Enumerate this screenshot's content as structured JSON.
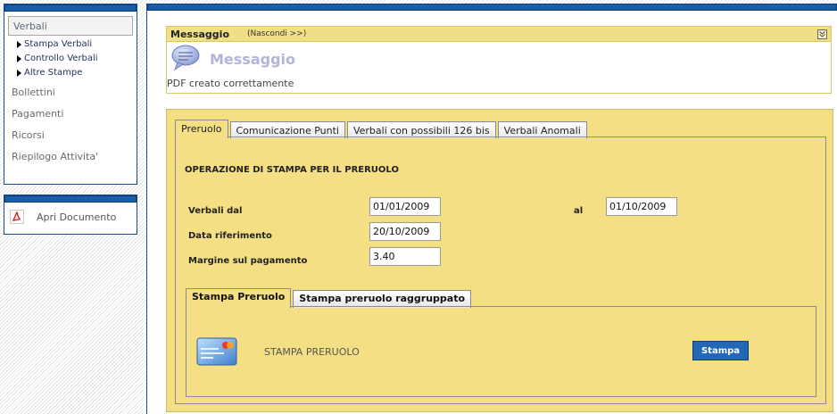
{
  "sidebar": {
    "section_header": "Verbali",
    "sub_items": [
      {
        "label": "Stampa Verbali"
      },
      {
        "label": "Controllo Verbali"
      },
      {
        "label": "Altre Stampe"
      }
    ],
    "nav_items": [
      {
        "label": "Bollettini"
      },
      {
        "label": "Pagamenti"
      },
      {
        "label": "Ricorsi"
      },
      {
        "label": "Riepilogo Attivita'"
      }
    ],
    "documents": {
      "open_label": "Apri Documento",
      "icon": "pdf-icon"
    }
  },
  "message": {
    "header_title": "Messaggio",
    "hide_link": "(Nascondi >>)",
    "heading": "Messaggio",
    "text": "PDF creato correttamente",
    "icons": [
      "speech-bubble-icon",
      "collapse-icon"
    ]
  },
  "tabs": [
    {
      "label": "Preruolo",
      "active": true
    },
    {
      "label": "Comunicazione Punti",
      "active": false
    },
    {
      "label": "Verbali con possibili 126 bis",
      "active": false
    },
    {
      "label": "Verbali Anomali",
      "active": false
    }
  ],
  "form": {
    "title": "OPERAZIONE DI STAMPA PER IL PRERUOLO",
    "verbali_dal": {
      "label": "Verbali dal",
      "value": "01/01/2009"
    },
    "al": {
      "label": "al",
      "value": "01/10/2009"
    },
    "data_riferimento": {
      "label": "Data riferimento",
      "value": "20/10/2009"
    },
    "margine": {
      "label": "Margine sul pagamento",
      "value": "3.40"
    }
  },
  "subtabs": [
    {
      "label": "Stampa Preruolo",
      "active": true
    },
    {
      "label": "Stampa preruolo raggruppato",
      "active": false
    }
  ],
  "print_section": {
    "label": "STAMPA PRERUOLO",
    "button": "Stampa",
    "icon": "credit-card-icon"
  },
  "colors": {
    "brand_blue": "#1b5ea8",
    "panel_yellow": "#f4df84",
    "message_header": "#f1df86",
    "button_blue": "#2467b6"
  }
}
